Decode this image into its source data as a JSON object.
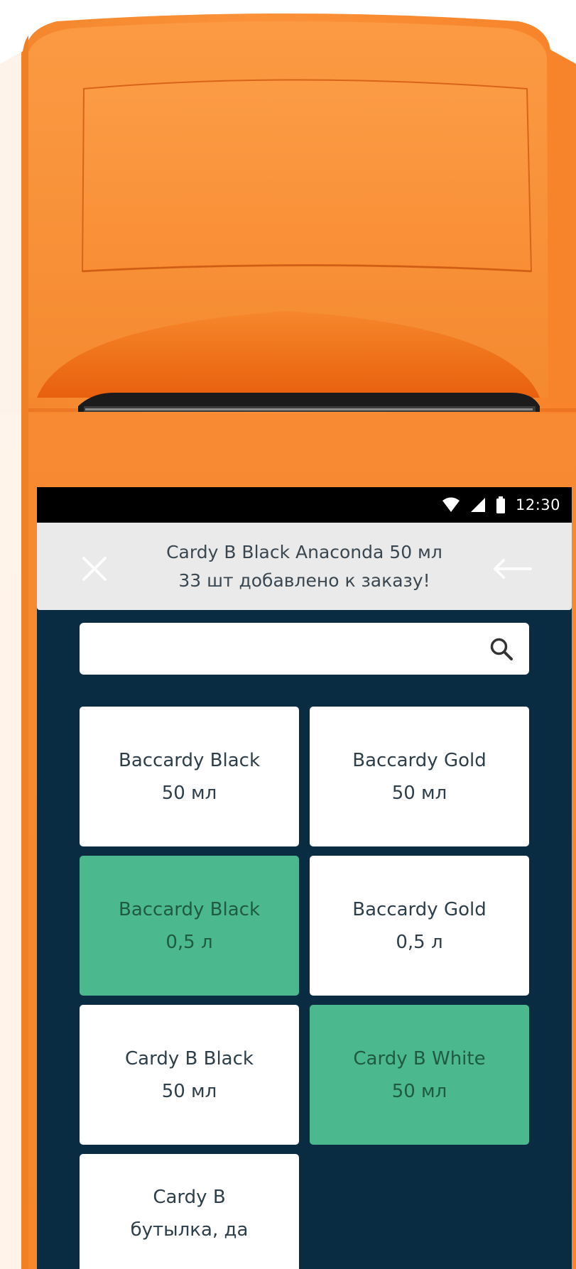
{
  "status_bar": {
    "time": "12:30",
    "icons": [
      "wifi-icon",
      "signal-icon",
      "battery-icon"
    ]
  },
  "toast": {
    "line1": "Cardy B Black Anaconda 50 мл",
    "line2": "33 шт добавлено к заказу!"
  },
  "header": {
    "left_icon": "close-icon",
    "right_icon": "back-arrow-icon"
  },
  "search": {
    "value": "",
    "placeholder": "",
    "icon": "search-icon"
  },
  "products": [
    {
      "name": "Baccardy Black",
      "volume": "50 мл",
      "selected": false
    },
    {
      "name": "Baccardy Gold",
      "volume": "50 мл",
      "selected": false
    },
    {
      "name": "Baccardy Black",
      "volume": "0,5 л",
      "selected": true
    },
    {
      "name": "Baccardy Gold",
      "volume": "0,5 л",
      "selected": false
    },
    {
      "name": "Cardy B Black",
      "volume": "50 мл",
      "selected": false
    },
    {
      "name": "Cardy B White",
      "volume": "50 мл",
      "selected": true
    },
    {
      "name": "Cardy B",
      "volume": "бутылка, да",
      "selected": false
    }
  ],
  "colors": {
    "device_orange": "#f7872a",
    "screen_bg": "#0a2c42",
    "header_bg": "#eaeaea",
    "tile_white": "#ffffff",
    "tile_selected": "#4cb88e"
  }
}
